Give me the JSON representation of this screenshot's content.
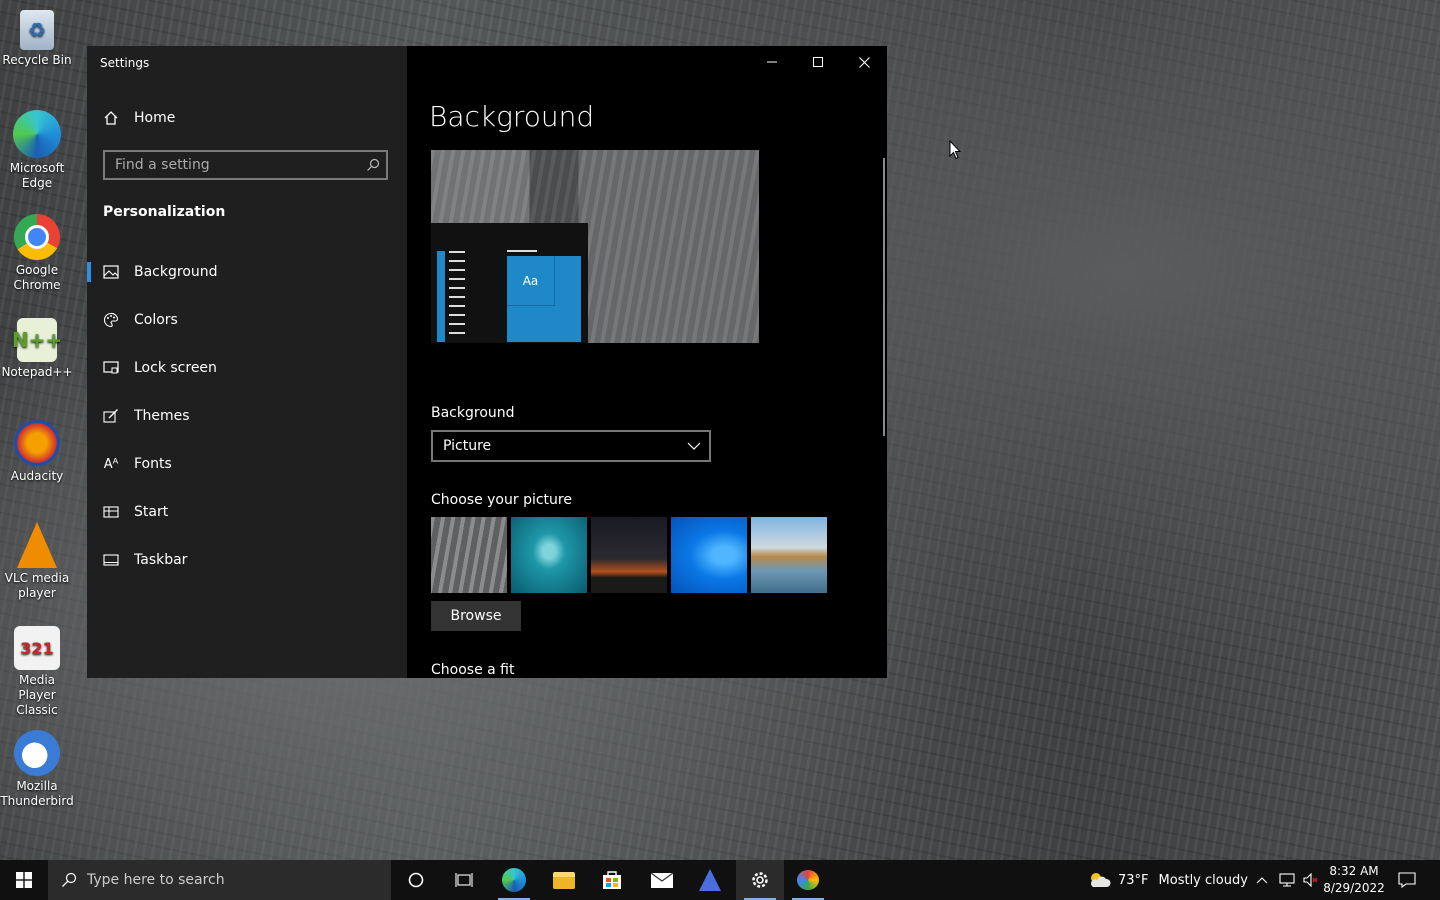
{
  "desktop": {
    "icons": [
      {
        "label": "Recycle Bin",
        "icon": "recycle-bin-icon",
        "color": "#c9d6e3"
      },
      {
        "label": "Microsoft Edge",
        "icon": "edge-icon",
        "color": "#1f9fd8"
      },
      {
        "label": "Google Chrome",
        "icon": "chrome-icon",
        "color": "#e94235"
      },
      {
        "label": "Notepad++",
        "icon": "notepad-plus-plus-icon",
        "color": "#8cc152"
      },
      {
        "label": "Audacity",
        "icon": "audacity-icon",
        "color": "#f0a30a"
      },
      {
        "label": "VLC media player",
        "icon": "vlc-icon",
        "color": "#f08c00"
      },
      {
        "label": "Media Player Classic",
        "icon": "media-player-classic-icon",
        "color": "#e6e6e6"
      },
      {
        "label": "Mozilla Thunderbird",
        "icon": "thunderbird-icon",
        "color": "#3a7bd5"
      }
    ]
  },
  "settings": {
    "window_title": "Settings",
    "home_label": "Home",
    "search_placeholder": "Find a setting",
    "section_title": "Personalization",
    "nav_items": [
      {
        "label": "Background",
        "icon": "picture-icon",
        "active": true
      },
      {
        "label": "Colors",
        "icon": "palette-icon",
        "active": false
      },
      {
        "label": "Lock screen",
        "icon": "lock-screen-icon",
        "active": false
      },
      {
        "label": "Themes",
        "icon": "brush-icon",
        "active": false
      },
      {
        "label": "Fonts",
        "icon": "font-icon",
        "active": false
      },
      {
        "label": "Start",
        "icon": "start-icon",
        "active": false
      },
      {
        "label": "Taskbar",
        "icon": "taskbar-icon",
        "active": false
      }
    ],
    "page_title": "Background",
    "preview_tile_text": "Aa",
    "background_label": "Background",
    "background_value": "Picture",
    "choose_picture_label": "Choose your picture",
    "browse_label": "Browse",
    "choose_fit_label": "Choose a fit",
    "accent_color": "#1e88c8"
  },
  "taskbar": {
    "search_placeholder": "Type here to search",
    "weather_temp": "73°F",
    "weather_desc": "Mostly cloudy",
    "time": "8:32 AM",
    "date": "8/29/2022"
  }
}
